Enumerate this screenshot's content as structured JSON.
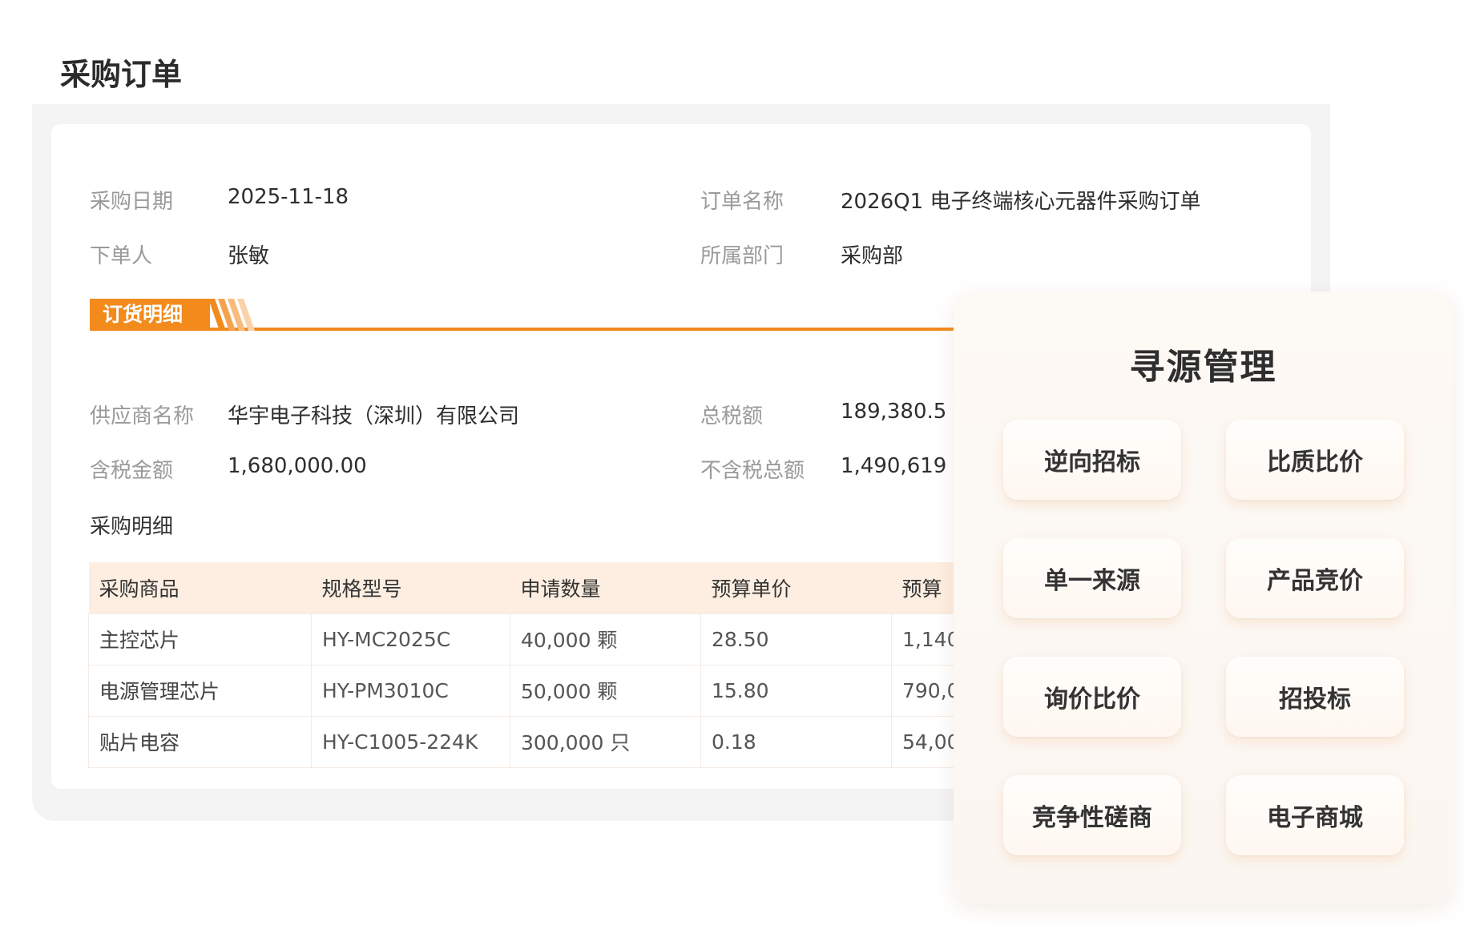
{
  "page": {
    "title": "采购订单"
  },
  "order_info": {
    "purchase_date": {
      "label": "采购日期",
      "value": "2025-11-18"
    },
    "order_name": {
      "label": "订单名称",
      "value": "2026Q1 电子终端核心元器件采购订单"
    },
    "orderer": {
      "label": "下单人",
      "value": "张敏"
    },
    "department": {
      "label": "所属部门",
      "value": "采购部"
    }
  },
  "section": {
    "title": "订货明细"
  },
  "supplier_info": {
    "supplier_name": {
      "label": "供应商名称",
      "value": "华宇电子科技（深圳）有限公司"
    },
    "total_tax": {
      "label": "总税额",
      "value": "189,380.5"
    },
    "amount_incl_tax": {
      "label": "含税金额",
      "value": "1,680,000.00"
    },
    "amount_excl_tax": {
      "label": "不含税总额",
      "value": "1,490,619"
    }
  },
  "purchase_detail": {
    "heading": "采购明细",
    "columns": [
      "采购商品",
      "规格型号",
      "申请数量",
      "预算单价",
      "预算"
    ],
    "rows": [
      [
        "主控芯片",
        "HY-MC2025C",
        "40,000 颗",
        "28.50",
        "1,140"
      ],
      [
        "电源管理芯片",
        "HY-PM3010C",
        "50,000 颗",
        "15.80",
        "790,0"
      ],
      [
        "贴片电容",
        "HY-C1005-224K",
        "300,000 只",
        "0.18",
        "54,00"
      ]
    ]
  },
  "sourcing": {
    "title": "寻源管理",
    "buttons": [
      "逆向招标",
      "比质比价",
      "单一来源",
      "产品竞价",
      "询价比价",
      "招投标",
      "竞争性磋商",
      "电子商城"
    ]
  },
  "colors": {
    "accent": "#f28a1c",
    "table_header_bg": "#fdeee1",
    "panel_bg": "#fbf6f1"
  }
}
